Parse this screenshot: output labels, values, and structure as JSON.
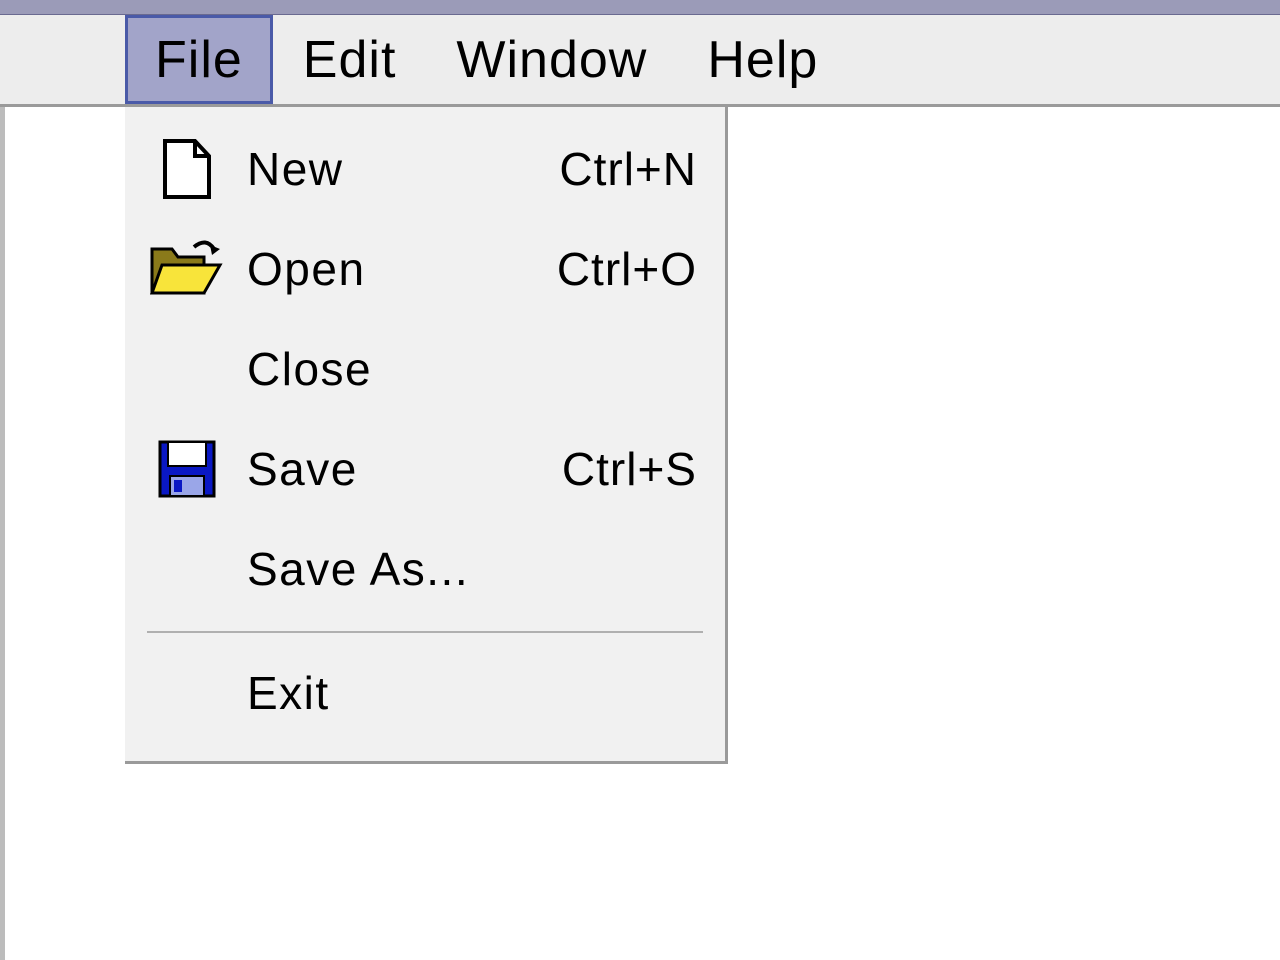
{
  "menubar": {
    "items": [
      {
        "label": "File",
        "active": true
      },
      {
        "label": "Edit",
        "active": false
      },
      {
        "label": "Window",
        "active": false
      },
      {
        "label": "Help",
        "active": false
      }
    ]
  },
  "dropdown": {
    "items": [
      {
        "icon": "new-file-icon",
        "label": "New",
        "shortcut": "Ctrl+N"
      },
      {
        "icon": "open-folder-icon",
        "label": "Open",
        "shortcut": "Ctrl+O"
      },
      {
        "icon": "",
        "label": "Close",
        "shortcut": ""
      },
      {
        "icon": "save-disk-icon",
        "label": "Save",
        "shortcut": "Ctrl+S"
      },
      {
        "icon": "",
        "label": "Save As...",
        "shortcut": ""
      },
      {
        "separator": true
      },
      {
        "icon": "",
        "label": "Exit",
        "shortcut": ""
      }
    ]
  }
}
